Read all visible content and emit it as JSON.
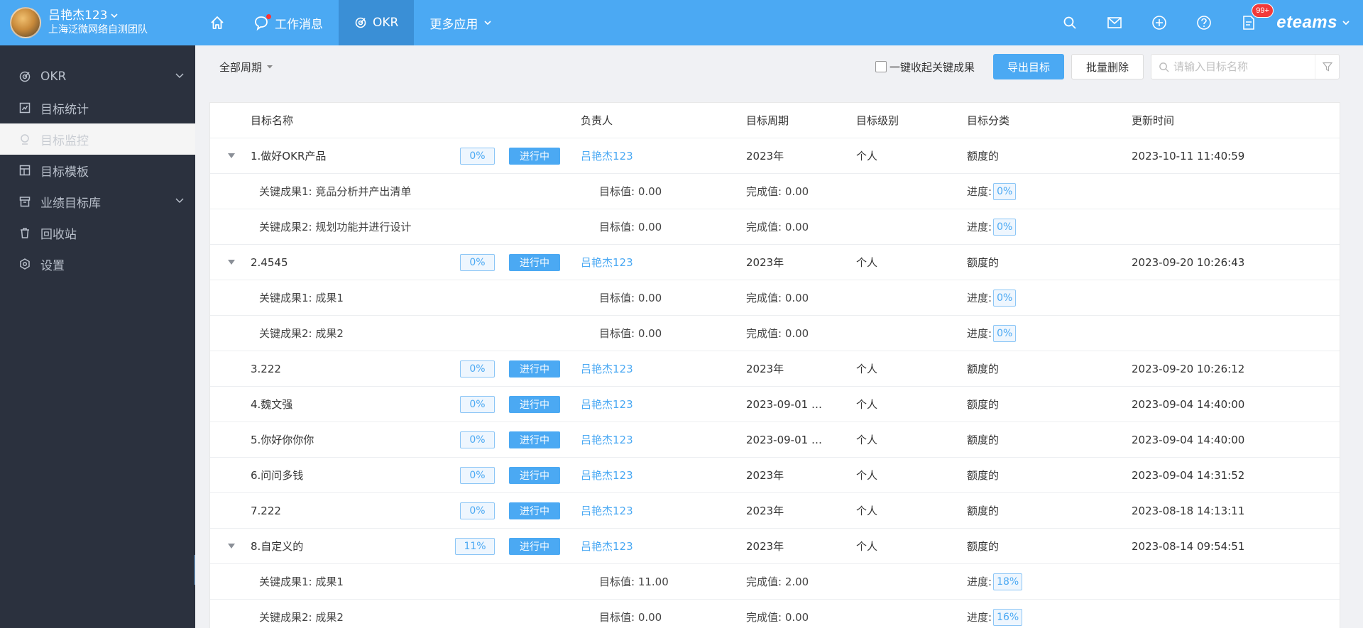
{
  "user": {
    "name": "吕艳杰123",
    "team": "上海泛微网络自测团队"
  },
  "nav": {
    "items": [
      {
        "label": "工作消息"
      },
      {
        "label": "OKR"
      },
      {
        "label": "更多应用"
      }
    ]
  },
  "topbar": {
    "badge": "99+",
    "logo": "eteams"
  },
  "sidebar": {
    "items": [
      {
        "label": "OKR"
      },
      {
        "label": "目标统计"
      },
      {
        "label": "目标监控"
      },
      {
        "label": "目标模板"
      },
      {
        "label": "业绩目标库"
      },
      {
        "label": "回收站"
      },
      {
        "label": "设置"
      }
    ]
  },
  "toolbar": {
    "period": "全部周期",
    "collapse_label": "一键收起关键成果",
    "export_label": "导出目标",
    "batch_delete_label": "批量删除",
    "search_placeholder": "请输入目标名称"
  },
  "table": {
    "headers": {
      "name": "目标名称",
      "owner": "负责人",
      "period": "目标周期",
      "level": "目标级别",
      "category": "目标分类",
      "updated": "更新时间"
    },
    "rows": [
      {
        "type": "goal",
        "name": "1.做好OKR产品",
        "pct": "0%",
        "status": "进行中",
        "owner": "吕艳杰123",
        "period": "2023年",
        "level": "个人",
        "category": "额度的",
        "updated": "2023-10-11 11:40:59"
      },
      {
        "type": "kr",
        "name": "关键成果1: 竞品分析并产出清单",
        "target": "目标值: 0.00",
        "done": "完成值: 0.00",
        "progress_label": "进度:",
        "progress": "0%"
      },
      {
        "type": "kr",
        "name": "关键成果2: 规划功能并进行设计",
        "target": "目标值: 0.00",
        "done": "完成值: 0.00",
        "progress_label": "进度:",
        "progress": "0%"
      },
      {
        "type": "goal",
        "name": "2.4545",
        "pct": "0%",
        "status": "进行中",
        "owner": "吕艳杰123",
        "period": "2023年",
        "level": "个人",
        "category": "额度的",
        "updated": "2023-09-20 10:26:43"
      },
      {
        "type": "kr",
        "name": "关键成果1: 成果1",
        "target": "目标值: 0.00",
        "done": "完成值: 0.00",
        "progress_label": "进度:",
        "progress": "0%"
      },
      {
        "type": "kr",
        "name": "关键成果2: 成果2",
        "target": "目标值: 0.00",
        "done": "完成值: 0.00",
        "progress_label": "进度:",
        "progress": "0%"
      },
      {
        "type": "goal",
        "name": "3.222",
        "pct": "0%",
        "status": "进行中",
        "owner": "吕艳杰123",
        "period": "2023年",
        "level": "个人",
        "category": "额度的",
        "updated": "2023-09-20 10:26:12"
      },
      {
        "type": "goal",
        "name": "4.魏文强",
        "pct": "0%",
        "status": "进行中",
        "owner": "吕艳杰123",
        "period": "2023-09-01 ~ 2...",
        "level": "个人",
        "category": "额度的",
        "updated": "2023-09-04 14:40:00"
      },
      {
        "type": "goal",
        "name": "5.你好你你你",
        "pct": "0%",
        "status": "进行中",
        "owner": "吕艳杰123",
        "period": "2023-09-01 ~ 2...",
        "level": "个人",
        "category": "额度的",
        "updated": "2023-09-04 14:40:00"
      },
      {
        "type": "goal",
        "name": "6.问问多钱",
        "pct": "0%",
        "status": "进行中",
        "owner": "吕艳杰123",
        "period": "2023年",
        "level": "个人",
        "category": "额度的",
        "updated": "2023-09-04 14:31:52"
      },
      {
        "type": "goal",
        "name": "7.222",
        "pct": "0%",
        "status": "进行中",
        "owner": "吕艳杰123",
        "period": "2023年",
        "level": "个人",
        "category": "额度的",
        "updated": "2023-08-18 14:13:11"
      },
      {
        "type": "goal",
        "name": "8.自定义的",
        "pct": "11%",
        "status": "进行中",
        "owner": "吕艳杰123",
        "period": "2023年",
        "level": "个人",
        "category": "额度的",
        "updated": "2023-08-14 09:54:51"
      },
      {
        "type": "kr",
        "name": "关键成果1: 成果1",
        "target": "目标值: 11.00",
        "done": "完成值: 2.00",
        "progress_label": "进度:",
        "progress": "18%"
      },
      {
        "type": "kr",
        "name": "关键成果2: 成果2",
        "target": "目标值: 0.00",
        "done": "完成值: 0.00",
        "progress_label": "进度:",
        "progress": "16%"
      }
    ]
  }
}
